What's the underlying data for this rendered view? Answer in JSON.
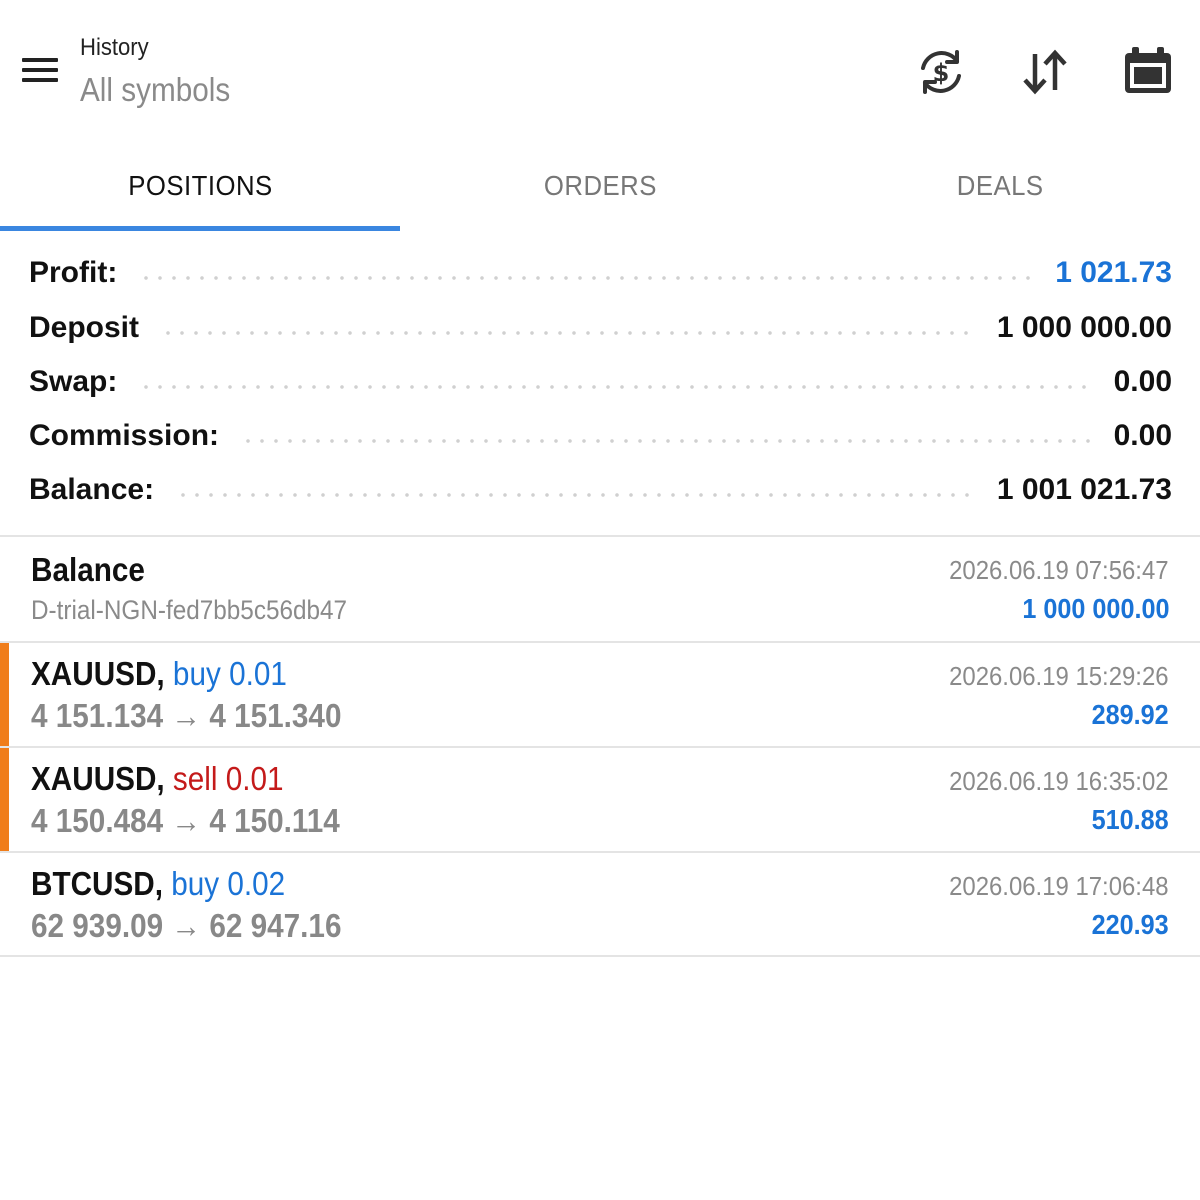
{
  "header": {
    "title": "History",
    "subtitle": "All symbols",
    "icons": [
      "menu-icon",
      "currency-exchange-icon",
      "sort-icon",
      "calendar-icon"
    ]
  },
  "tabs": [
    {
      "label": "POSITIONS",
      "active": true
    },
    {
      "label": "ORDERS",
      "active": false
    },
    {
      "label": "DEALS",
      "active": false
    }
  ],
  "summary": [
    {
      "label": "Profit:",
      "value": "1 021.73",
      "highlight": true
    },
    {
      "label": "Deposit",
      "value": "1 000 000.00",
      "highlight": false
    },
    {
      "label": "Swap:",
      "value": "0.00",
      "highlight": false
    },
    {
      "label": "Commission:",
      "value": "0.00",
      "highlight": false
    },
    {
      "label": "Balance:",
      "value": "1 001 021.73",
      "highlight": false
    }
  ],
  "balance_entry": {
    "title": "Balance",
    "comment": "D-trial-NGN-fed7bb5c56db47",
    "time": "2026.06.19 07:56:47",
    "amount": "1 000 000.00"
  },
  "positions": [
    {
      "symbol": "XAUUSD,",
      "side": "buy",
      "side_text": "buy 0.01",
      "prices": "4 151.134 → 4 151.340",
      "time": "2026.06.19 15:29:26",
      "profit": "289.92",
      "accent": true
    },
    {
      "symbol": "XAUUSD,",
      "side": "sell",
      "side_text": "sell 0.01",
      "prices": "4 150.484 → 4 150.114",
      "time": "2026.06.19 16:35:02",
      "profit": "510.88",
      "accent": true
    },
    {
      "symbol": "BTCUSD,",
      "side": "buy",
      "side_text": "buy 0.02",
      "prices": "62 939.09 → 62 947.16",
      "time": "2026.06.19 17:06:48",
      "profit": "220.93",
      "accent": false
    }
  ],
  "colors": {
    "accent_blue": "#1a73d6",
    "tab_indicator": "#3a86e0",
    "sell_red": "#c41a1a",
    "row_accent_orange": "#f07d1a",
    "muted_gray": "#8a8a8a"
  }
}
